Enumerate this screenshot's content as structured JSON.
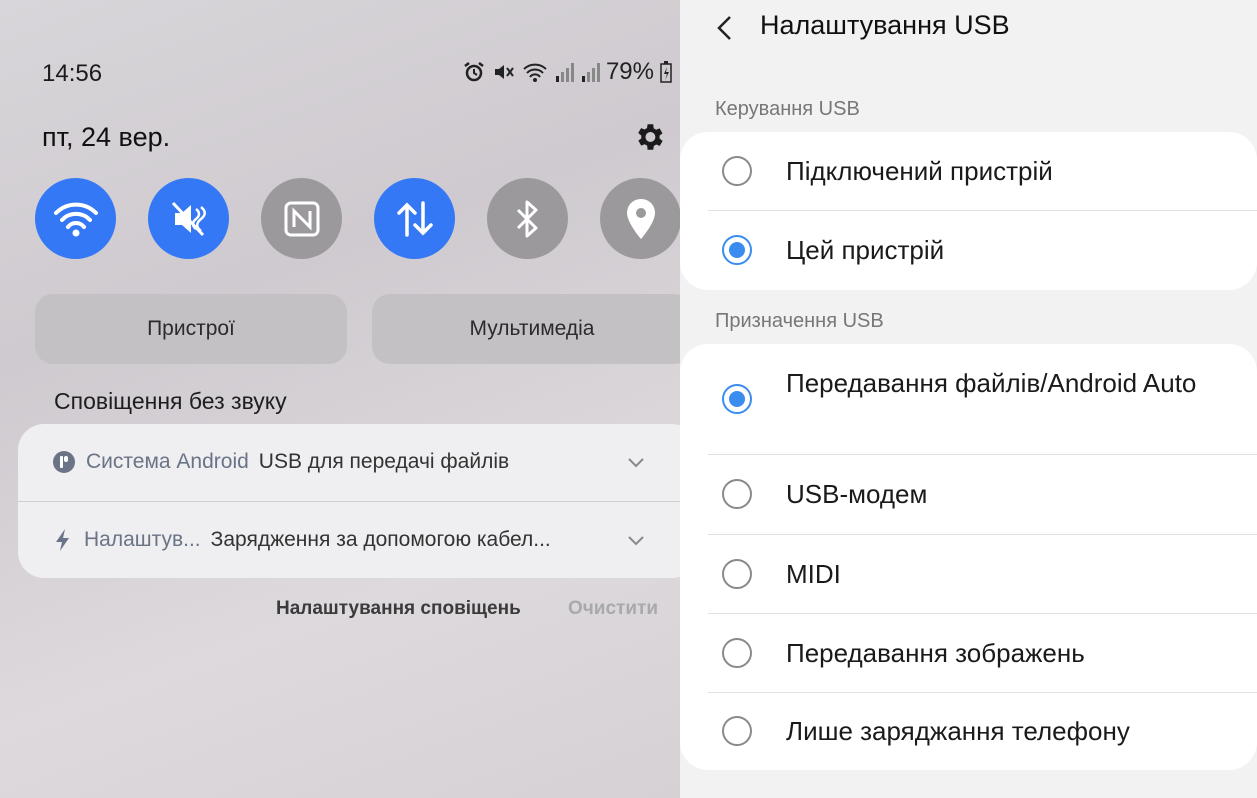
{
  "status": {
    "time": "14:56",
    "battery": "79%"
  },
  "panel": {
    "date": "пт, 24 вер.",
    "quick_settings": [
      {
        "name": "wifi",
        "state": "on"
      },
      {
        "name": "mute",
        "state": "on"
      },
      {
        "name": "nfc",
        "state": "off"
      },
      {
        "name": "mobile-data",
        "state": "on"
      },
      {
        "name": "bluetooth",
        "state": "off"
      },
      {
        "name": "location",
        "state": "off"
      }
    ],
    "devices_label": "Пристрої",
    "media_label": "Мультимедіа",
    "silent_title": "Сповіщення без звуку",
    "notifications": [
      {
        "app": "Система Android",
        "text": "USB для передачі файлів"
      },
      {
        "app": "Налаштув...",
        "text": "Зарядження за допомогою кабел..."
      }
    ],
    "notif_settings_label": "Налаштування сповіщень",
    "clear_label": "Очистити"
  },
  "usb": {
    "title": "Налаштування USB",
    "control_label": "Керування USB",
    "control_options": [
      {
        "label": "Підключений пристрій",
        "checked": false
      },
      {
        "label": "Цей пристрій",
        "checked": true
      }
    ],
    "purpose_label": "Призначення USB",
    "purpose_options": [
      {
        "label": "Передавання файлів/Android Auto",
        "checked": true
      },
      {
        "label": "USB-модем",
        "checked": false
      },
      {
        "label": "MIDI",
        "checked": false
      },
      {
        "label": "Передавання зображень",
        "checked": false
      },
      {
        "label": "Лише заряджання телефону",
        "checked": false
      }
    ]
  },
  "colors": {
    "accent": "#3478f6",
    "radio": "#3a8cf0",
    "tile_off": "#9b999c"
  }
}
